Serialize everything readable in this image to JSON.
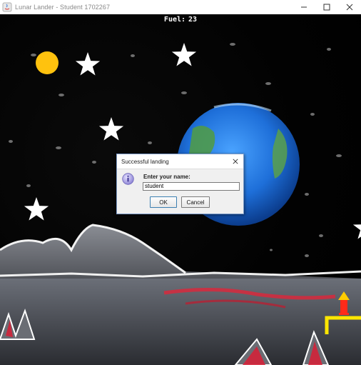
{
  "window": {
    "title": "Lunar Lander - Student 1702267",
    "controls": [
      "minimize",
      "maximize",
      "close"
    ]
  },
  "hud": {
    "fuel_label": "Fuel:",
    "fuel_value": "23"
  },
  "dialog": {
    "title": "Successful landing",
    "prompt": "Enter your name:",
    "input_value": "student",
    "ok_label": "OK",
    "cancel_label": "Cancel",
    "icon": "info-icon"
  },
  "scene": {
    "sun_color": "#ffc20e",
    "star_color": "#ffffff",
    "planet": "earth",
    "lander_color": "#ff2a1a",
    "landing_pad_color": "#ffe600"
  }
}
